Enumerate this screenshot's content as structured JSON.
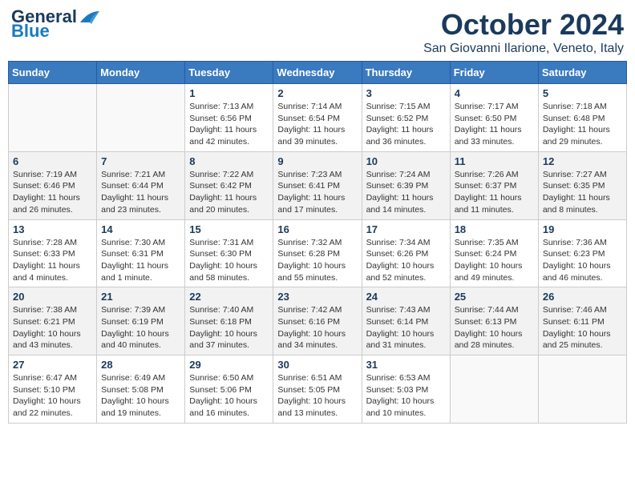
{
  "logo": {
    "text_general": "General",
    "text_blue": "Blue"
  },
  "header": {
    "month": "October 2024",
    "location": "San Giovanni Ilarione, Veneto, Italy"
  },
  "days_of_week": [
    "Sunday",
    "Monday",
    "Tuesday",
    "Wednesday",
    "Thursday",
    "Friday",
    "Saturday"
  ],
  "weeks": [
    [
      {
        "day": "",
        "info": ""
      },
      {
        "day": "",
        "info": ""
      },
      {
        "day": "1",
        "info": "Sunrise: 7:13 AM\nSunset: 6:56 PM\nDaylight: 11 hours and 42 minutes."
      },
      {
        "day": "2",
        "info": "Sunrise: 7:14 AM\nSunset: 6:54 PM\nDaylight: 11 hours and 39 minutes."
      },
      {
        "day": "3",
        "info": "Sunrise: 7:15 AM\nSunset: 6:52 PM\nDaylight: 11 hours and 36 minutes."
      },
      {
        "day": "4",
        "info": "Sunrise: 7:17 AM\nSunset: 6:50 PM\nDaylight: 11 hours and 33 minutes."
      },
      {
        "day": "5",
        "info": "Sunrise: 7:18 AM\nSunset: 6:48 PM\nDaylight: 11 hours and 29 minutes."
      }
    ],
    [
      {
        "day": "6",
        "info": "Sunrise: 7:19 AM\nSunset: 6:46 PM\nDaylight: 11 hours and 26 minutes."
      },
      {
        "day": "7",
        "info": "Sunrise: 7:21 AM\nSunset: 6:44 PM\nDaylight: 11 hours and 23 minutes."
      },
      {
        "day": "8",
        "info": "Sunrise: 7:22 AM\nSunset: 6:42 PM\nDaylight: 11 hours and 20 minutes."
      },
      {
        "day": "9",
        "info": "Sunrise: 7:23 AM\nSunset: 6:41 PM\nDaylight: 11 hours and 17 minutes."
      },
      {
        "day": "10",
        "info": "Sunrise: 7:24 AM\nSunset: 6:39 PM\nDaylight: 11 hours and 14 minutes."
      },
      {
        "day": "11",
        "info": "Sunrise: 7:26 AM\nSunset: 6:37 PM\nDaylight: 11 hours and 11 minutes."
      },
      {
        "day": "12",
        "info": "Sunrise: 7:27 AM\nSunset: 6:35 PM\nDaylight: 11 hours and 8 minutes."
      }
    ],
    [
      {
        "day": "13",
        "info": "Sunrise: 7:28 AM\nSunset: 6:33 PM\nDaylight: 11 hours and 4 minutes."
      },
      {
        "day": "14",
        "info": "Sunrise: 7:30 AM\nSunset: 6:31 PM\nDaylight: 11 hours and 1 minute."
      },
      {
        "day": "15",
        "info": "Sunrise: 7:31 AM\nSunset: 6:30 PM\nDaylight: 10 hours and 58 minutes."
      },
      {
        "day": "16",
        "info": "Sunrise: 7:32 AM\nSunset: 6:28 PM\nDaylight: 10 hours and 55 minutes."
      },
      {
        "day": "17",
        "info": "Sunrise: 7:34 AM\nSunset: 6:26 PM\nDaylight: 10 hours and 52 minutes."
      },
      {
        "day": "18",
        "info": "Sunrise: 7:35 AM\nSunset: 6:24 PM\nDaylight: 10 hours and 49 minutes."
      },
      {
        "day": "19",
        "info": "Sunrise: 7:36 AM\nSunset: 6:23 PM\nDaylight: 10 hours and 46 minutes."
      }
    ],
    [
      {
        "day": "20",
        "info": "Sunrise: 7:38 AM\nSunset: 6:21 PM\nDaylight: 10 hours and 43 minutes."
      },
      {
        "day": "21",
        "info": "Sunrise: 7:39 AM\nSunset: 6:19 PM\nDaylight: 10 hours and 40 minutes."
      },
      {
        "day": "22",
        "info": "Sunrise: 7:40 AM\nSunset: 6:18 PM\nDaylight: 10 hours and 37 minutes."
      },
      {
        "day": "23",
        "info": "Sunrise: 7:42 AM\nSunset: 6:16 PM\nDaylight: 10 hours and 34 minutes."
      },
      {
        "day": "24",
        "info": "Sunrise: 7:43 AM\nSunset: 6:14 PM\nDaylight: 10 hours and 31 minutes."
      },
      {
        "day": "25",
        "info": "Sunrise: 7:44 AM\nSunset: 6:13 PM\nDaylight: 10 hours and 28 minutes."
      },
      {
        "day": "26",
        "info": "Sunrise: 7:46 AM\nSunset: 6:11 PM\nDaylight: 10 hours and 25 minutes."
      }
    ],
    [
      {
        "day": "27",
        "info": "Sunrise: 6:47 AM\nSunset: 5:10 PM\nDaylight: 10 hours and 22 minutes."
      },
      {
        "day": "28",
        "info": "Sunrise: 6:49 AM\nSunset: 5:08 PM\nDaylight: 10 hours and 19 minutes."
      },
      {
        "day": "29",
        "info": "Sunrise: 6:50 AM\nSunset: 5:06 PM\nDaylight: 10 hours and 16 minutes."
      },
      {
        "day": "30",
        "info": "Sunrise: 6:51 AM\nSunset: 5:05 PM\nDaylight: 10 hours and 13 minutes."
      },
      {
        "day": "31",
        "info": "Sunrise: 6:53 AM\nSunset: 5:03 PM\nDaylight: 10 hours and 10 minutes."
      },
      {
        "day": "",
        "info": ""
      },
      {
        "day": "",
        "info": ""
      }
    ]
  ]
}
